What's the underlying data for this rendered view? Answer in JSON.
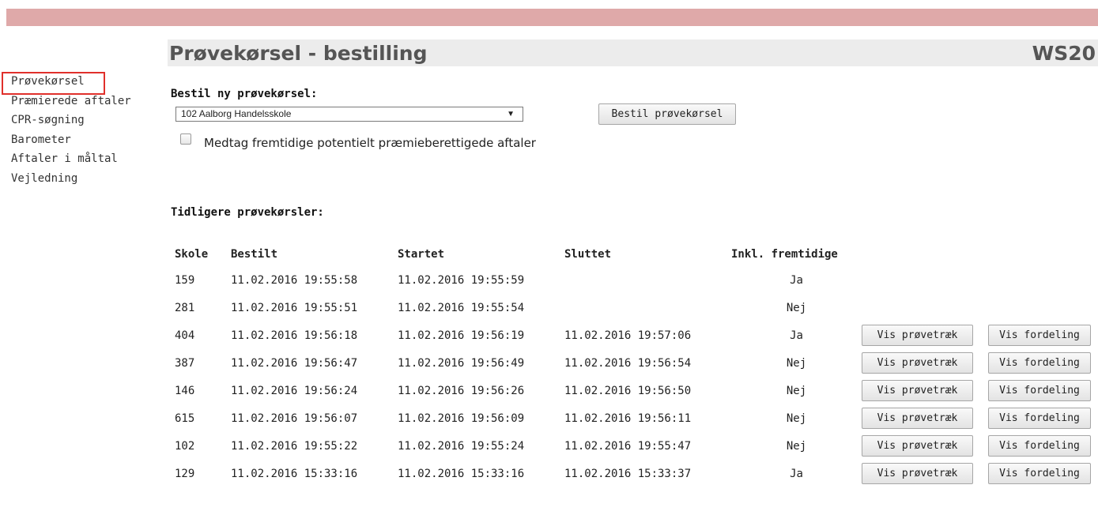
{
  "header": {
    "title": "Prøvekørsel - bestilling",
    "ws_label": "WS20",
    "accent_color": "#dfa9a9"
  },
  "sidebar": {
    "items": [
      {
        "label": "Prøvekørsel"
      },
      {
        "label": "Præmierede aftaler"
      },
      {
        "label": "CPR-søgning"
      },
      {
        "label": "Barometer"
      },
      {
        "label": "Aftaler i måltal"
      },
      {
        "label": "Vejledning"
      }
    ]
  },
  "order": {
    "heading": "Bestil ny prøvekørsel:",
    "school_select_value": "102 Aalborg Handelsskole",
    "select_arrow": "▼",
    "order_button_label": "Bestil prøvekørsel",
    "checkbox_label": "Medtag fremtidige potentielt præmieberettigede aftaler",
    "checkbox_checked": false
  },
  "history": {
    "heading": "Tidligere prøvekørsler:",
    "columns": [
      "Skole",
      "Bestilt",
      "Startet",
      "Sluttet",
      "Inkl. fremtidige"
    ],
    "button_labels": {
      "draws": "Vis prøvetræk",
      "distribution": "Vis fordeling"
    },
    "rows": [
      {
        "skole": "159",
        "bestilt": "11.02.2016 19:55:58",
        "startet": "11.02.2016 19:55:59",
        "sluttet": "",
        "inkl": "Ja"
      },
      {
        "skole": "281",
        "bestilt": "11.02.2016 19:55:51",
        "startet": "11.02.2016 19:55:54",
        "sluttet": "",
        "inkl": "Nej"
      },
      {
        "skole": "404",
        "bestilt": "11.02.2016 19:56:18",
        "startet": "11.02.2016 19:56:19",
        "sluttet": "11.02.2016 19:57:06",
        "inkl": "Ja"
      },
      {
        "skole": "387",
        "bestilt": "11.02.2016 19:56:47",
        "startet": "11.02.2016 19:56:49",
        "sluttet": "11.02.2016 19:56:54",
        "inkl": "Nej"
      },
      {
        "skole": "146",
        "bestilt": "11.02.2016 19:56:24",
        "startet": "11.02.2016 19:56:26",
        "sluttet": "11.02.2016 19:56:50",
        "inkl": "Nej"
      },
      {
        "skole": "615",
        "bestilt": "11.02.2016 19:56:07",
        "startet": "11.02.2016 19:56:09",
        "sluttet": "11.02.2016 19:56:11",
        "inkl": "Nej"
      },
      {
        "skole": "102",
        "bestilt": "11.02.2016 19:55:22",
        "startet": "11.02.2016 19:55:24",
        "sluttet": "11.02.2016 19:55:47",
        "inkl": "Nej"
      },
      {
        "skole": "129",
        "bestilt": "11.02.2016 15:33:16",
        "startet": "11.02.2016 15:33:16",
        "sluttet": "11.02.2016 15:33:37",
        "inkl": "Ja"
      }
    ]
  }
}
